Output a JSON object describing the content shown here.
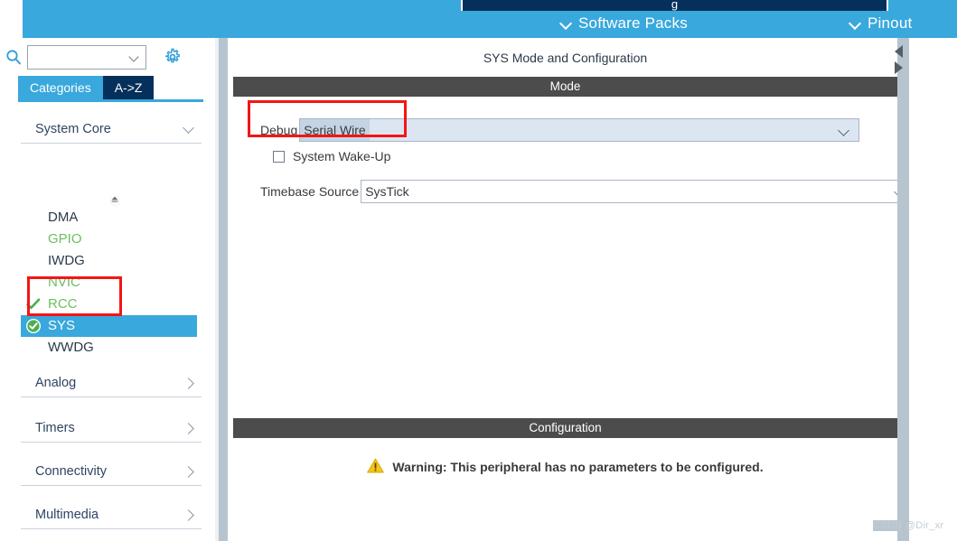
{
  "app": {
    "header": {
      "menus": [
        {
          "label": "Software Packs",
          "icon": "chevron-down-icon"
        },
        {
          "label": "Pinout",
          "icon": "chevron-down-icon"
        }
      ],
      "partial_tab_glyph": "g"
    }
  },
  "sidebar": {
    "search": {
      "value": "",
      "placeholder": ""
    },
    "icons": {
      "search": "search-icon",
      "gear": "gear-icon",
      "dropdown": "chevron-down-icon"
    },
    "tabs": [
      {
        "label": "Categories",
        "active": true
      },
      {
        "label": "A->Z",
        "active": false
      }
    ],
    "categories": [
      {
        "label": "System Core",
        "expanded": true
      },
      {
        "label": "Analog",
        "expanded": false
      },
      {
        "label": "Timers",
        "expanded": false
      },
      {
        "label": "Connectivity",
        "expanded": false
      },
      {
        "label": "Multimedia",
        "expanded": false
      }
    ],
    "peripherals": [
      {
        "label": "DMA",
        "state": "plain",
        "checked": false,
        "selected": false
      },
      {
        "label": "GPIO",
        "state": "green",
        "checked": false,
        "selected": false
      },
      {
        "label": "IWDG",
        "state": "plain",
        "checked": false,
        "selected": false
      },
      {
        "label": "NVIC",
        "state": "green",
        "checked": false,
        "selected": false
      },
      {
        "label": "RCC",
        "state": "green",
        "checked": true,
        "selected": false
      },
      {
        "label": "SYS",
        "state": "selected",
        "checked": true,
        "selected": true
      },
      {
        "label": "WWDG",
        "state": "plain",
        "checked": false,
        "selected": false
      }
    ]
  },
  "main": {
    "panel_title": "SYS Mode and Configuration",
    "mode": {
      "section_label": "Mode",
      "debug": {
        "label": "Debug",
        "value": "Serial Wire"
      },
      "system_wake_up": {
        "label": "System Wake-Up",
        "checked": false
      },
      "timebase_source": {
        "label": "Timebase Source",
        "value": "SysTick"
      }
    },
    "configuration": {
      "section_label": "Configuration",
      "warning_icon": "warning-triangle-icon",
      "warning_text": "Warning: This peripheral has no parameters to be configured."
    }
  },
  "watermark": {
    "prefix": "CSDN",
    "suffix": " @Dir_xr"
  },
  "colors": {
    "brand_blue": "#39a8dc",
    "dark_navy": "#06305c",
    "section_gray": "#4c4c4c",
    "green_text": "#6cbf5f",
    "annotation_red": "#f41515",
    "dropdown_blue": "#dbe6f2",
    "splitter": "#b6c4d0",
    "warning_yellow": "#f5c518"
  }
}
